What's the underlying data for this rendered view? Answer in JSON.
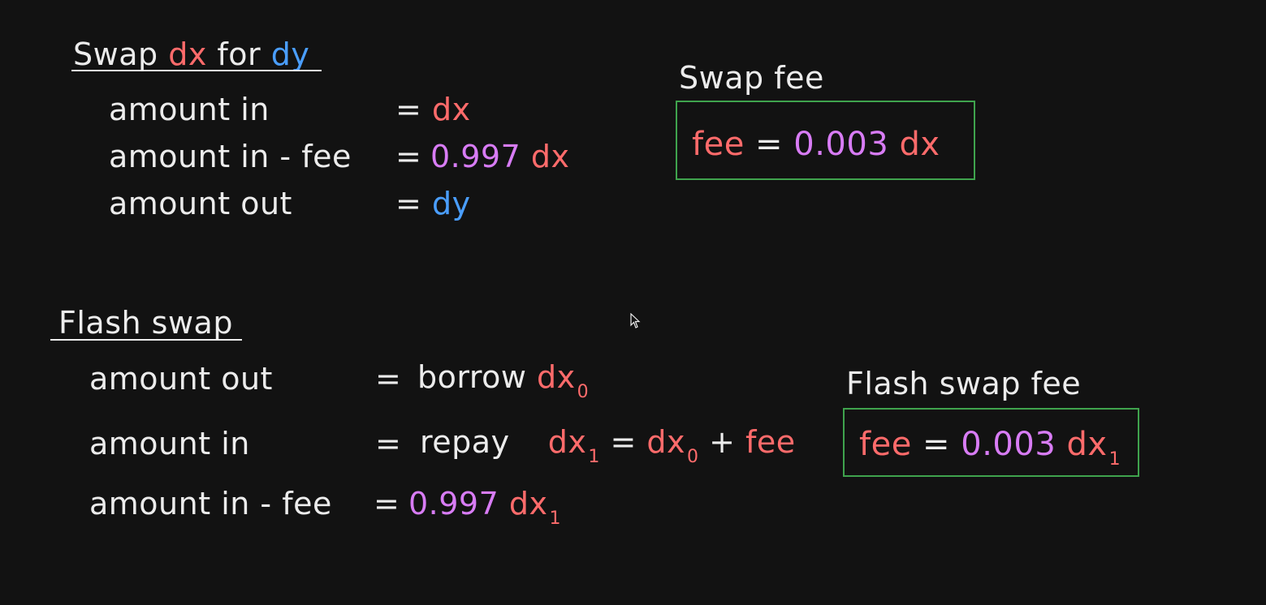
{
  "swap": {
    "title_prefix": "Swap",
    "title_dx": "dx",
    "title_for": "for",
    "title_dy": "dy",
    "rows": [
      {
        "label": "amount in",
        "eq": "=",
        "coef": "",
        "var": "dx"
      },
      {
        "label": "amount in - fee",
        "eq": "=",
        "coef": "0.997",
        "var": "dx"
      },
      {
        "label": "amount out",
        "eq": "=",
        "coef": "",
        "var": "dy"
      }
    ]
  },
  "swap_fee": {
    "title": "Swap fee",
    "lhs": "fee",
    "eq": "=",
    "coef": "0.003",
    "var": "dx"
  },
  "flash": {
    "title": "Flash swap",
    "row1": {
      "label": "amount out",
      "eq": "=",
      "word": "borrow",
      "var": "dx",
      "sub": "0"
    },
    "row2": {
      "label": "amount in",
      "eq": "=",
      "word": "repay",
      "var": "dx",
      "sub": "1",
      "eq2": "=",
      "var2": "dx",
      "sub2": "0",
      "plus": "+",
      "fee": "fee"
    },
    "row3": {
      "label": "amount in - fee",
      "eq": "=",
      "coef": "0.997",
      "var": "dx",
      "sub": "1"
    }
  },
  "flash_fee": {
    "title": "Flash swap fee",
    "lhs": "fee",
    "eq": "=",
    "coef": "0.003",
    "var": "dx",
    "sub": "1"
  },
  "colors": {
    "background": "#121212",
    "text": "#ececec",
    "red": "#ff6b6b",
    "blue": "#4a9eff",
    "purple": "#d87cf5",
    "box_border": "#3fa34d"
  }
}
